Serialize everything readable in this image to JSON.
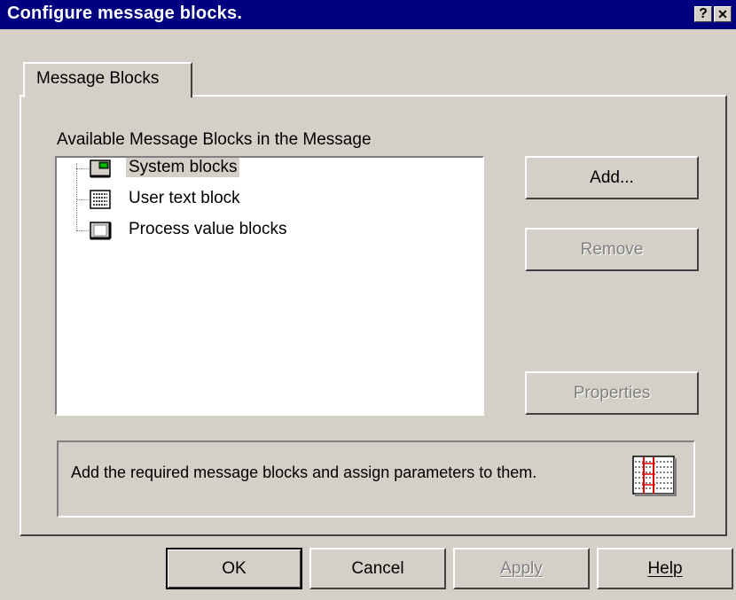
{
  "window": {
    "title": "Configure message blocks.",
    "help_glyph": "?",
    "close_glyph": "✕"
  },
  "tabs": [
    {
      "label": "Message Blocks",
      "active": true
    }
  ],
  "blocks_group": {
    "label": "Available Message Blocks in the Message",
    "items": [
      {
        "label": "System blocks",
        "icon": "system-block-icon",
        "selected": true
      },
      {
        "label": "User text block",
        "icon": "user-text-block-icon",
        "selected": false
      },
      {
        "label": "Process value blocks",
        "icon": "process-value-block-icon",
        "selected": false
      }
    ]
  },
  "side_buttons": {
    "add": {
      "label": "Add...",
      "enabled": true
    },
    "remove": {
      "label": "Remove",
      "enabled": false
    },
    "properties": {
      "label": "Properties",
      "enabled": false
    }
  },
  "info": {
    "text": "Add the required message blocks and assign parameters to them.",
    "icon": "message-block-table-icon"
  },
  "footer_buttons": {
    "ok": {
      "label": "OK",
      "enabled": true
    },
    "cancel": {
      "label": "Cancel",
      "enabled": true
    },
    "apply": {
      "label": "Apply",
      "enabled": false,
      "accel": "A"
    },
    "help": {
      "label": "Help",
      "enabled": true,
      "accel": "H"
    }
  },
  "colors": {
    "titlebar": "#000080",
    "face": "#d4d0c8",
    "disabled_text": "#808080"
  }
}
